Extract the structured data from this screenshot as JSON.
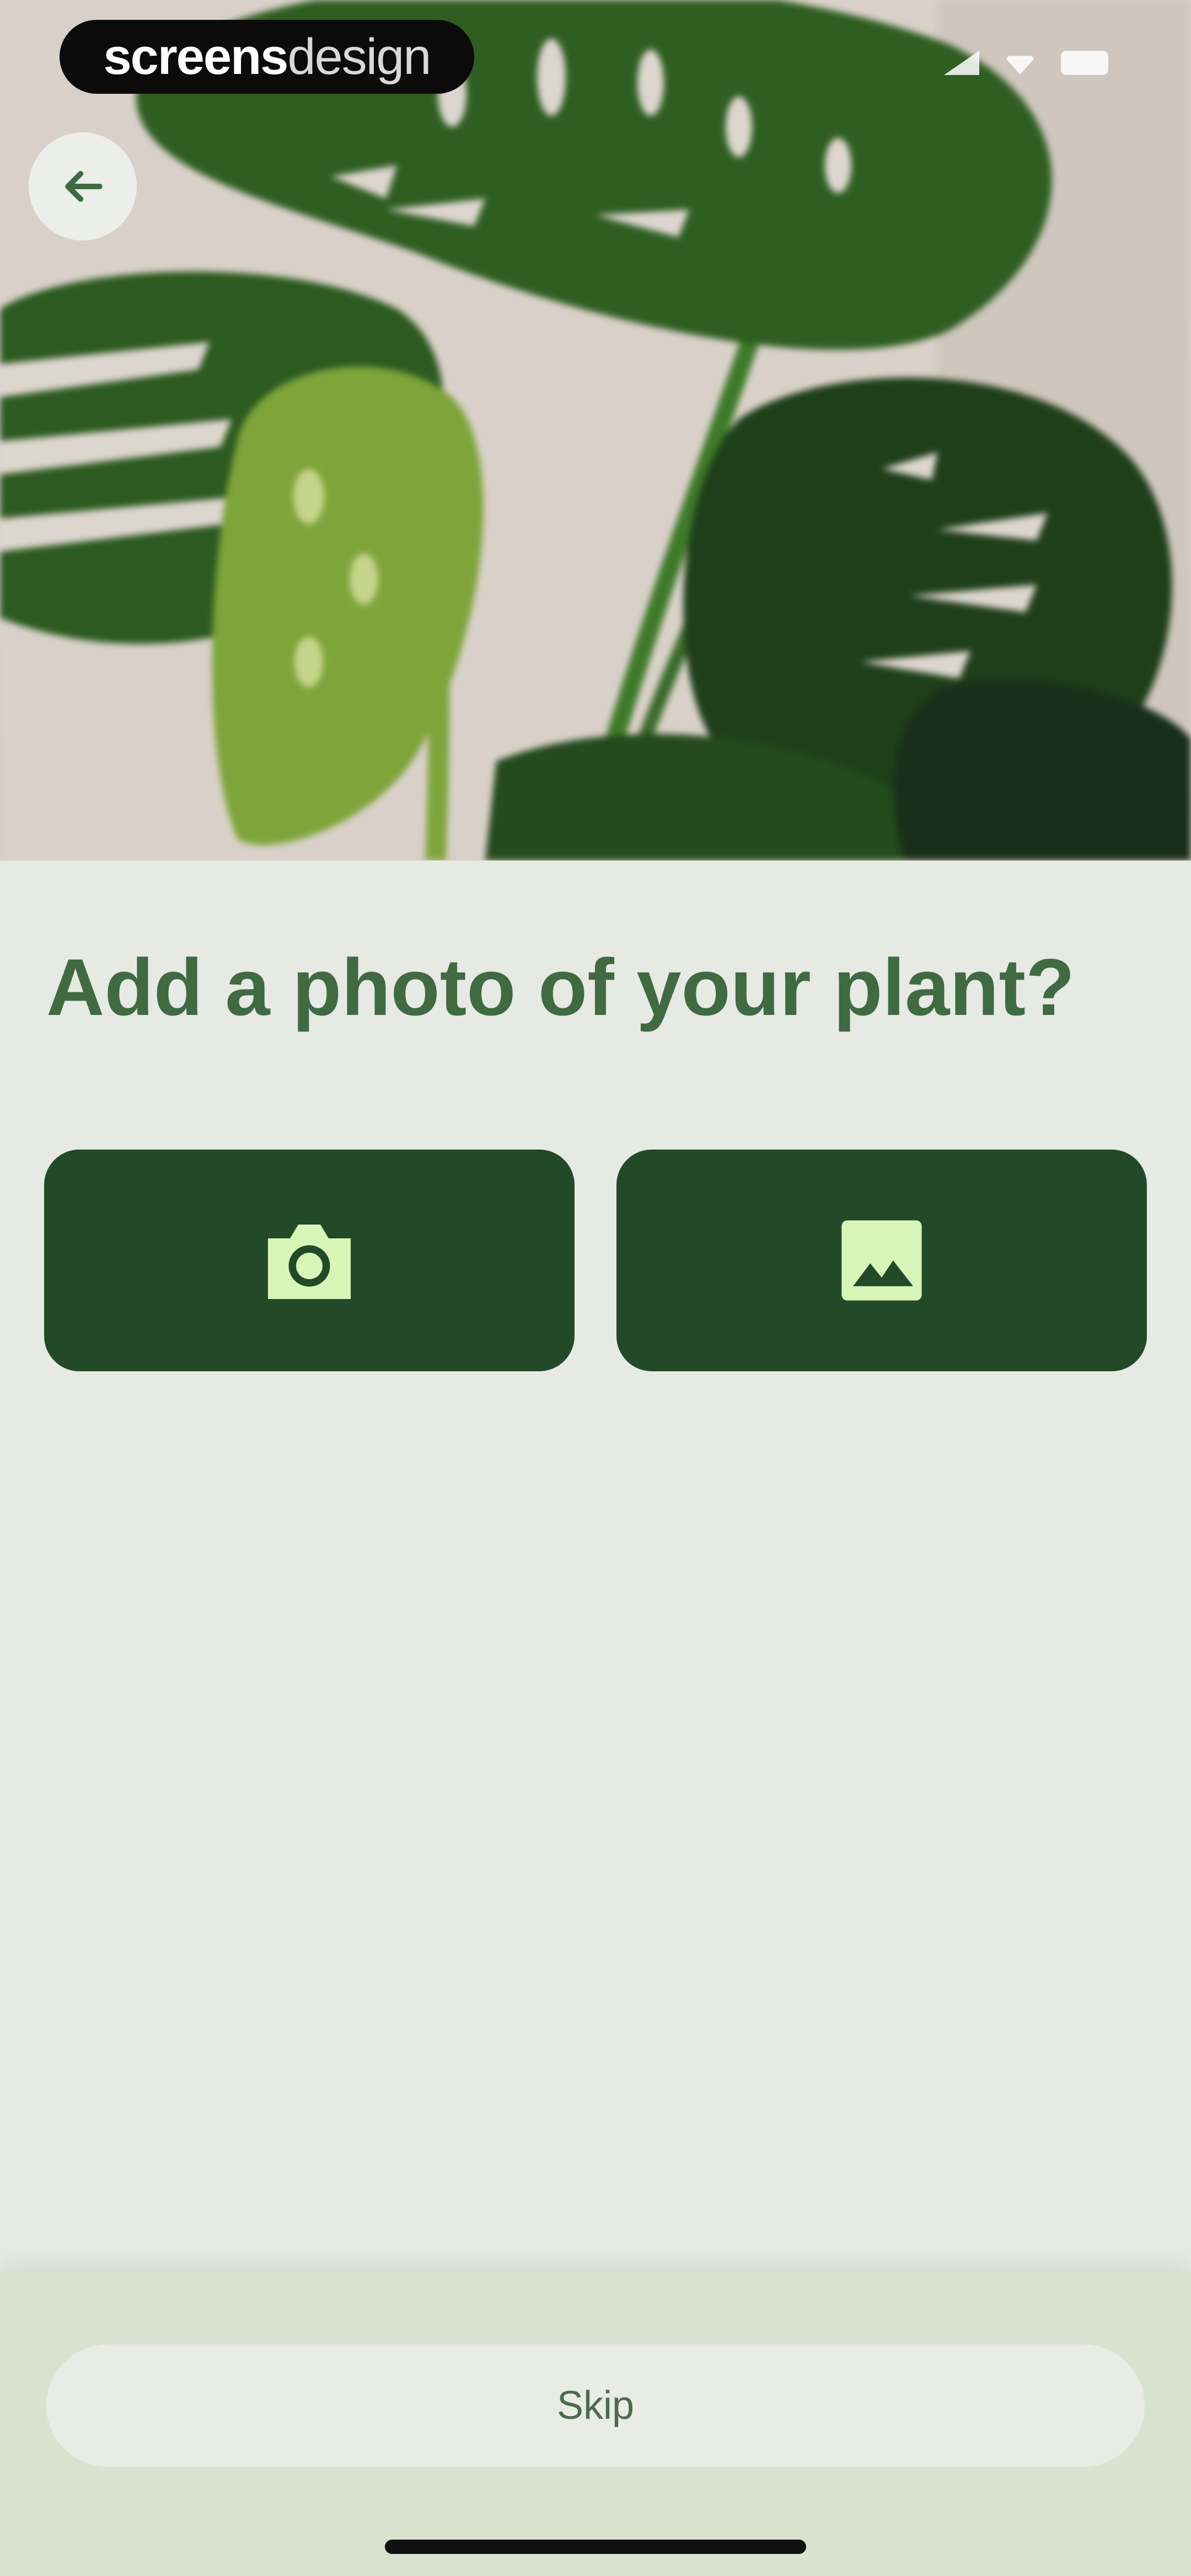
{
  "watermark": {
    "brand_bold": "screens",
    "brand_light": "design"
  },
  "header": {
    "back_icon": "arrow-left-icon"
  },
  "hero": {
    "image": "monstera plant photo"
  },
  "main": {
    "title": "Add a photo of your plant?",
    "options": [
      {
        "icon": "camera-icon"
      },
      {
        "icon": "image-gallery-icon"
      }
    ]
  },
  "footer": {
    "skip_label": "Skip"
  },
  "colors": {
    "background": "#e6eae3",
    "title": "#3f6a42",
    "button": "#234a28",
    "icon_fill": "#d8f5b8",
    "footer": "#d9e2cf"
  }
}
